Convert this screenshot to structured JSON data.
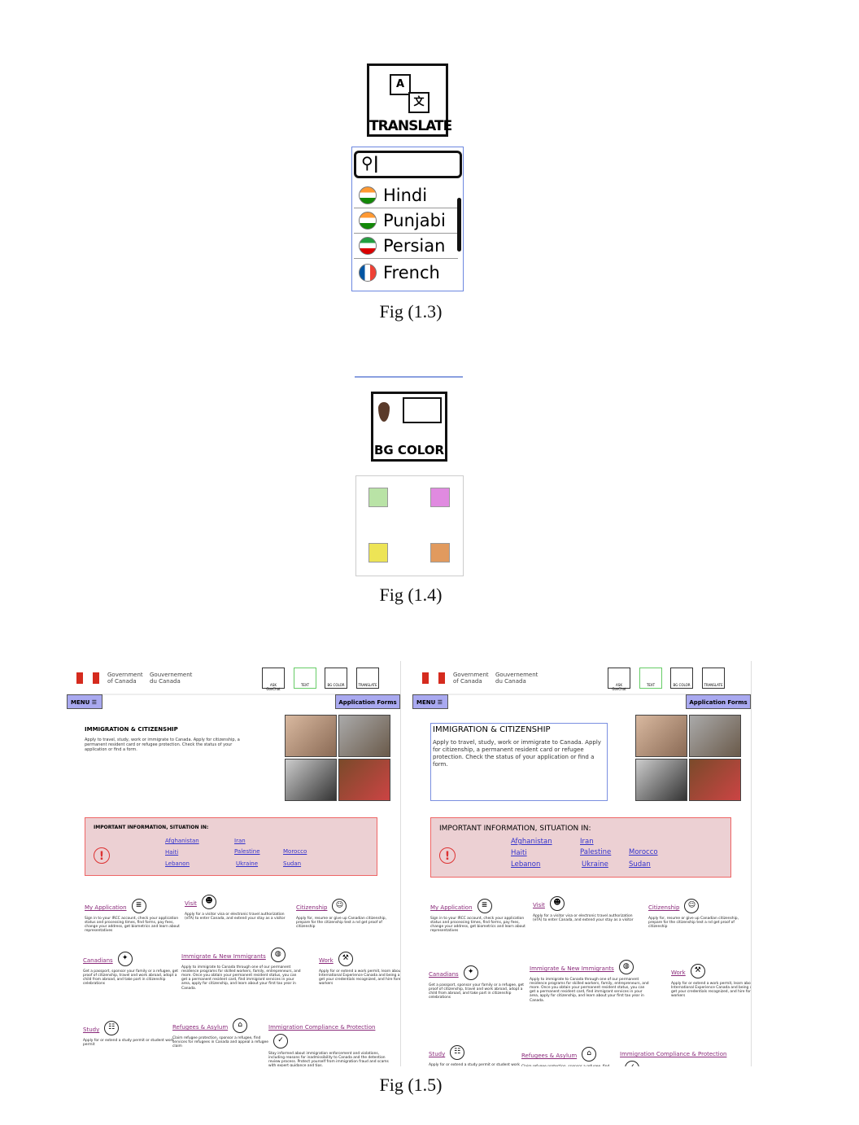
{
  "fig13": {
    "caption": "Fig (1.3)",
    "translate_label": "TRANSLATE",
    "box_a": "A",
    "box_x": "文",
    "languages": [
      {
        "label": "Hindi",
        "flag": "india"
      },
      {
        "label": "Punjabi",
        "flag": "india"
      },
      {
        "label": "Persian",
        "flag": "iran"
      },
      {
        "label": "French",
        "flag": "france"
      }
    ]
  },
  "fig14": {
    "caption": "Fig (1.4)",
    "bgcolor_label": "BG COLOR",
    "swatches": [
      "#b9e3a6",
      "#e08ae0",
      "#ede456",
      "#e19a5e"
    ]
  },
  "fig15": {
    "caption": "Fig (1.5)",
    "gov_en": "Government of Canada",
    "gov_fr": "Gouvernement du Canada",
    "tools": [
      "ASK GovChat",
      "TEXT",
      "BG COLOR",
      "TRANSLATE"
    ],
    "menu": "MENU ☰",
    "app_forms": "Application Forms",
    "title": "IMMIGRATION & CITIZENSHIP",
    "intro": "Apply to travel, study, work or immigrate to Canada. Apply for citizenship, a permanent resident card or refugee protection. Check the status of your application or find a form.",
    "info_title": "IMPORTANT INFORMATION, SITUATION IN:",
    "countries": [
      "Afghanistan",
      "Haiti",
      "Lebanon",
      "Iran",
      "Palestine",
      "Ukraine",
      "Morocco",
      "Sudan"
    ],
    "services": [
      {
        "title": "My Application",
        "desc": "Sign in to your IRCC account, check your application status and processing times, find forms, pay fees, change your address, get biometrics and learn about representatives",
        "icon": "document-icon"
      },
      {
        "title": "Visit",
        "desc": "Apply for a visitor visa or electronic travel authorization (eTA) to enter Canada, and extend your stay as a visitor",
        "icon": "visitor-icon"
      },
      {
        "title": "Citizenship",
        "desc": "Apply for, resume or give up Canadian citizenship, prepare for the citizenship test a nd get proof of citizenship",
        "icon": "citizen-icon"
      },
      {
        "title": "Canadians",
        "desc": "Get a passport, sponsor your family or a refugee, get proof of citizenship, travel and work abroad, adopt a child from abroad, and take part in citizenship celebrations",
        "icon": "maple-leaf-icon"
      },
      {
        "title": "Immigrate & New Immigrants",
        "desc": "Apply to immigrate to Canada through one of our permanent residence programs for skilled workers, family, entrepreneurs, and more. Once you obtain your permanent resident status, you can get a permanent resident card, find immigrant services in your area, apply for citizenship, and learn about your first tax year in Canada.",
        "icon": "globe-icon"
      },
      {
        "title": "Work",
        "desc": "Apply for or extend a work permit, learn about International Experience Canada and being a caregiver, get your credentials recognized, and hire foreign workers",
        "icon": "worker-icon"
      },
      {
        "title": "Study",
        "desc": "Apply for or extend a study permit or student work permit",
        "icon": "study-icon"
      },
      {
        "title": "Refugees & Asylum",
        "desc": "Claim refugee protection, sponsor a refugee, find services for refugees in Canada and appeal a refugee claim",
        "icon": "refugee-icon"
      },
      {
        "title": "Immigration Compliance & Protection",
        "desc": "Stay informed about immigration enforcement and violations, including reasons for inadmissibility to Canada and the detention review process. Protect yourself from immigration fraud and scams with expert guidance and tips.",
        "icon": "shield-check-icon"
      }
    ]
  }
}
